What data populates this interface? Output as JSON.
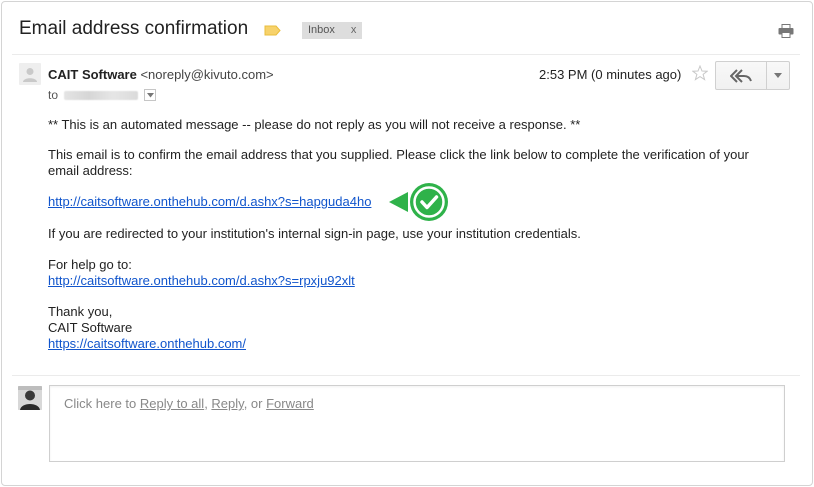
{
  "subject": "Email address confirmation",
  "label_chip": {
    "text": "Inbox",
    "remove": "x"
  },
  "icons": {
    "label_tag": "label-tag-icon",
    "print": "print-icon",
    "star": "star-icon",
    "reply_all": "reply-all-icon",
    "more": "chevron-down-icon",
    "check": "checkmark-icon"
  },
  "colors": {
    "label_tag": "#f7d26b",
    "link": "#1155cc",
    "check_green": "#2fb24a"
  },
  "message": {
    "sender_name": "CAIT Software",
    "sender_email": "<noreply@kivuto.com>",
    "to_label": "to",
    "time": "2:53 PM (0 minutes ago)",
    "paragraphs": {
      "automated": "** This is an automated message -- please do not reply as you will not receive a response. **",
      "confirm_line1": "This email is to confirm the email address that you supplied. Please click the link below to complete the verification of your",
      "confirm_line2": "email address:",
      "verify_link": "http://caitsoftware.onthehub.com/d.ashx?s=hapguda4ho",
      "redirect": "If you are redirected to your institution's internal sign-in page, use your institution credentials.",
      "help_intro": "For help go to:",
      "help_link": "http://caitsoftware.onthehub.com/d.ashx?s=rpxju92xlt",
      "thanks": "Thank you,",
      "signature": "CAIT Software",
      "site_link": "https://caitsoftware.onthehub.com/"
    }
  },
  "reply_box": {
    "prefix": "Click here to ",
    "reply_all": "Reply to all",
    "sep1": ", ",
    "reply": "Reply",
    "sep2": ", or ",
    "forward": "Forward"
  }
}
